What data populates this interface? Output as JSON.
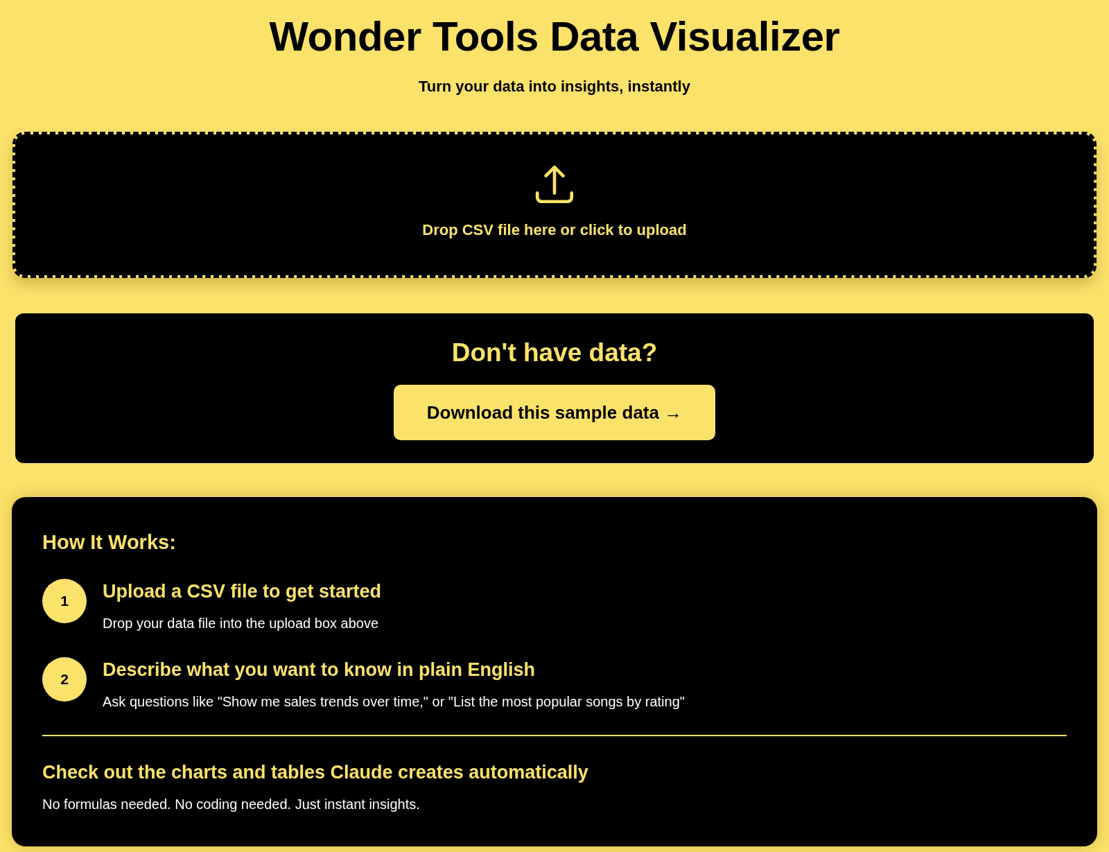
{
  "header": {
    "title": "Wonder Tools Data Visualizer",
    "subtitle": "Turn your data into insights, instantly"
  },
  "upload": {
    "label": "Drop CSV file here or click to upload"
  },
  "sample": {
    "heading": "Don't have data?",
    "button": "Download this sample data →"
  },
  "how_it_works": {
    "heading": "How It Works:",
    "steps": [
      {
        "number": "1",
        "title": "Upload a CSV file to get started",
        "description": "Drop your data file into the upload box above"
      },
      {
        "number": "2",
        "title": "Describe what you want to know in plain English",
        "description": "Ask questions like \"Show me sales trends over time,\" or \"List the most popular songs by rating\""
      }
    ],
    "footer": {
      "title": "Check out the charts and tables Claude creates automatically",
      "description": "No formulas needed. No coding needed. Just instant insights."
    }
  }
}
